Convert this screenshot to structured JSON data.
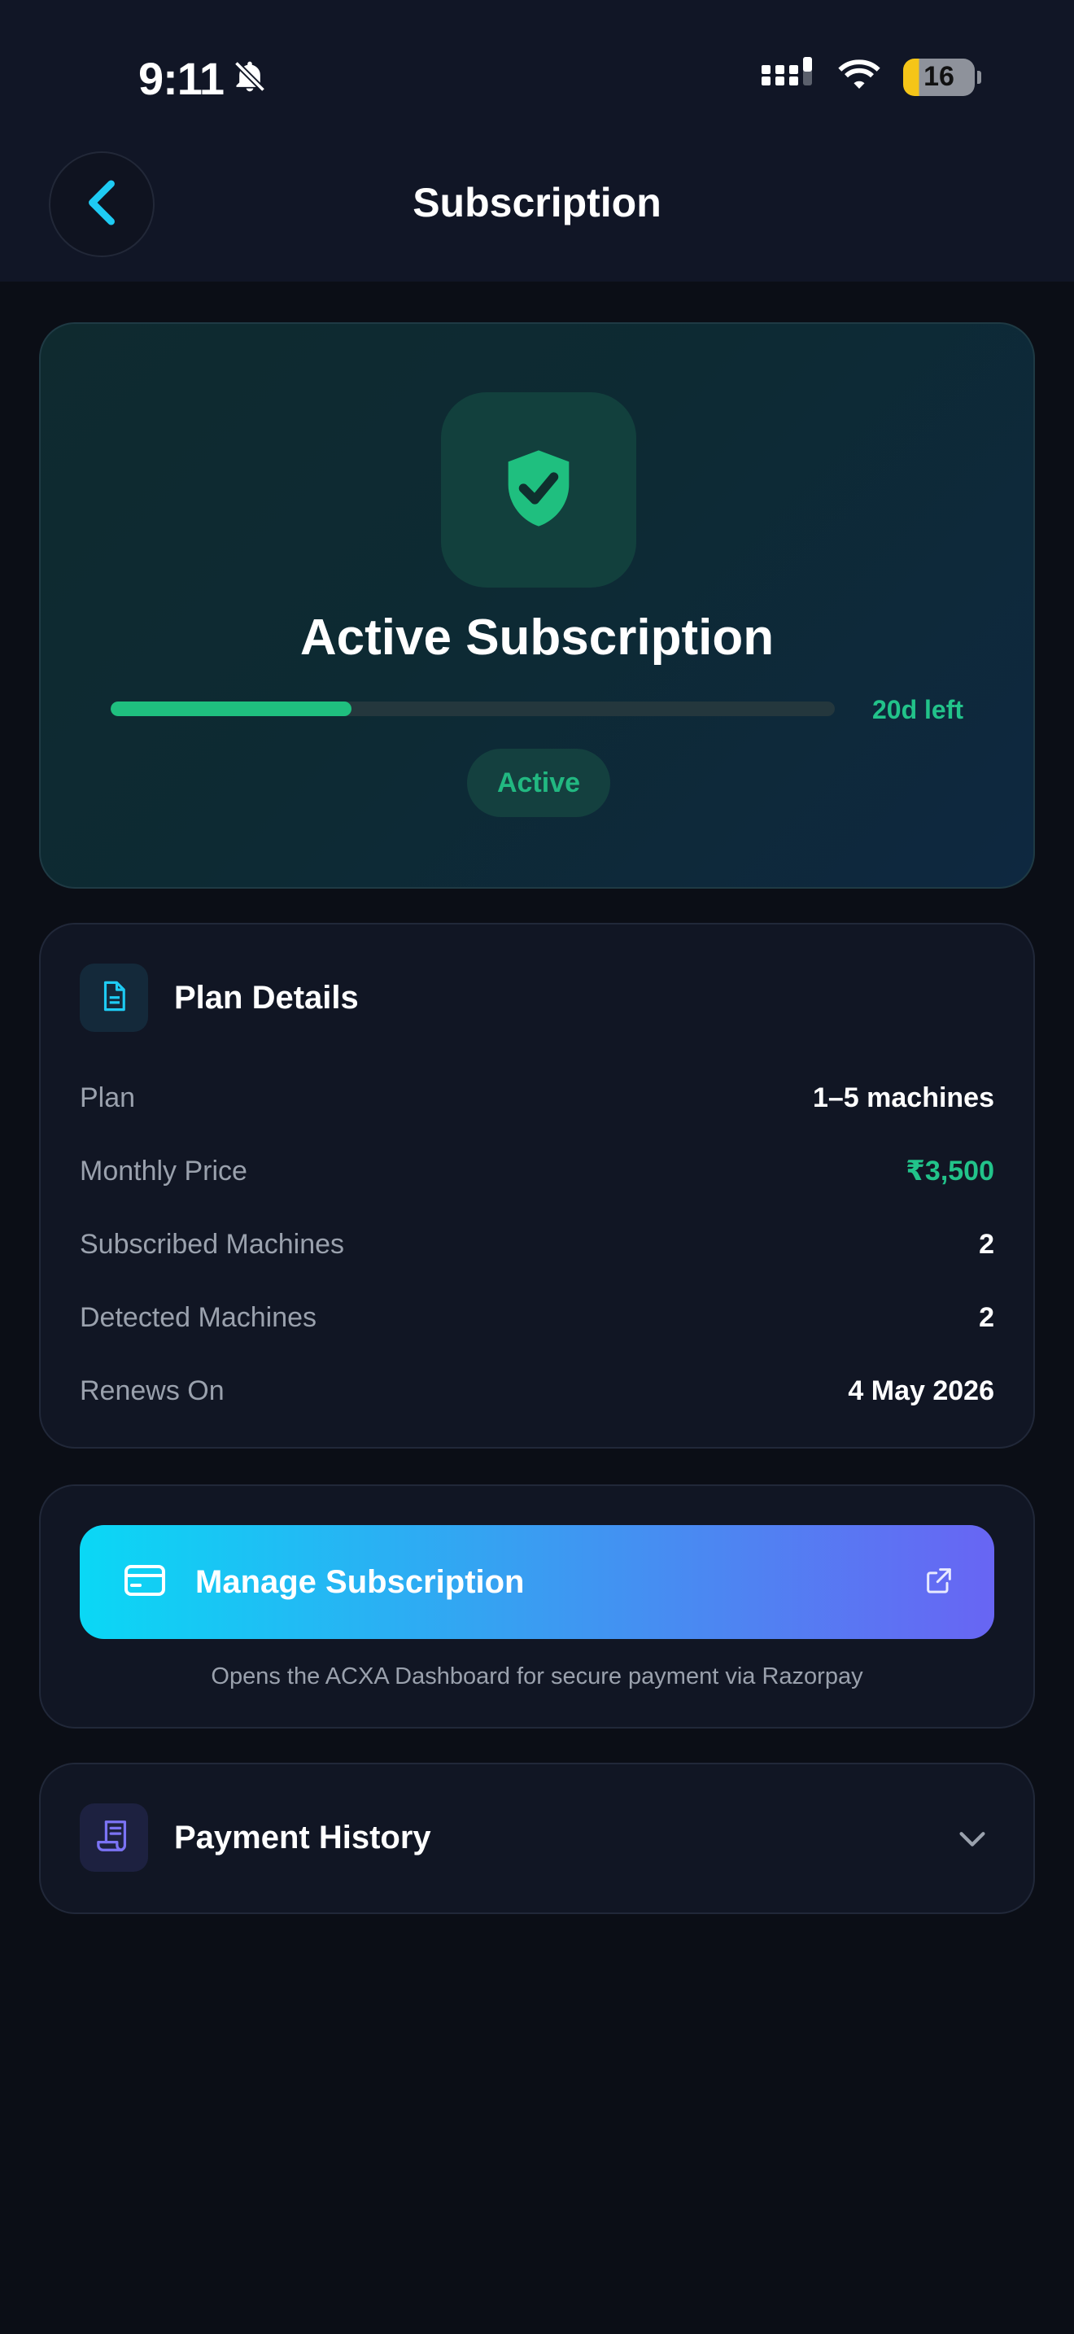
{
  "status_bar": {
    "time": "9:11",
    "battery": "16"
  },
  "header": {
    "title": "Subscription"
  },
  "hero": {
    "title": "Active Subscription",
    "progress_fraction": 0.333,
    "progress_label": "20d left",
    "status": "Active"
  },
  "plan_details": {
    "title": "Plan Details",
    "rows": [
      {
        "label": "Plan",
        "value": "1–5 machines"
      },
      {
        "label": "Monthly Price",
        "value": "₹3,500"
      },
      {
        "label": "Subscribed Machines",
        "value": "2"
      },
      {
        "label": "Detected Machines",
        "value": "2"
      },
      {
        "label": "Renews On",
        "value": "4 May 2026"
      }
    ]
  },
  "manage": {
    "button_label": "Manage Subscription",
    "note": "Opens the ACXA Dashboard for secure payment via Razorpay"
  },
  "payment_history": {
    "title": "Payment History"
  },
  "colors": {
    "accent_green": "#22c38a",
    "accent_cyan": "#0ad8f5",
    "accent_violet": "#6865f3",
    "background": "#0b0e16"
  },
  "icons": [
    "bell-slash-icon",
    "signal-icon",
    "wifi-icon",
    "battery-icon",
    "chevron-left-icon",
    "shield-check-icon",
    "document-icon",
    "credit-card-icon",
    "external-link-icon",
    "receipt-icon",
    "chevron-down-icon"
  ]
}
